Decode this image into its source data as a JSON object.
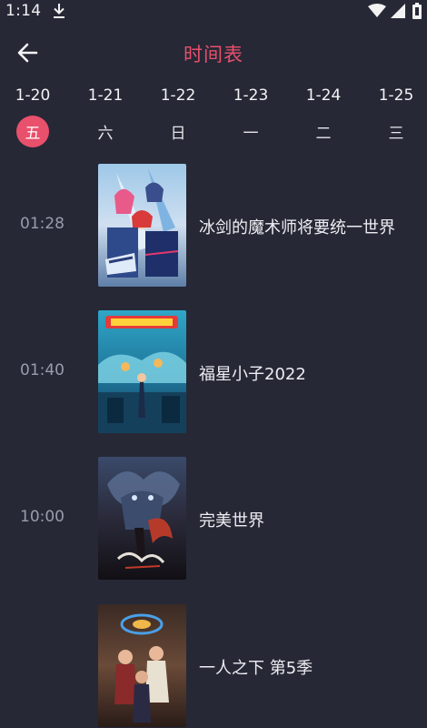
{
  "status": {
    "time": "1:14",
    "icons": [
      "download-icon",
      "wifi-icon",
      "cell-signal-icon",
      "battery-icon"
    ]
  },
  "header": {
    "title": "时间表",
    "back_icon": "arrow-left-icon",
    "accent_color": "#e8506b"
  },
  "dates": [
    {
      "date": "1-20",
      "day": "五",
      "active": true
    },
    {
      "date": "1-21",
      "day": "六"
    },
    {
      "date": "1-22",
      "day": "日"
    },
    {
      "date": "1-23",
      "day": "一"
    },
    {
      "date": "1-24",
      "day": "二"
    },
    {
      "date": "1-25",
      "day": "三"
    }
  ],
  "schedule": [
    {
      "time": "01:28",
      "title": "冰剑的魔术师将要统一世界"
    },
    {
      "time": "01:40",
      "title": "福星小子2022"
    },
    {
      "time": "10:00",
      "title": "完美世界"
    },
    {
      "time": "",
      "title": "一人之下 第5季"
    }
  ]
}
